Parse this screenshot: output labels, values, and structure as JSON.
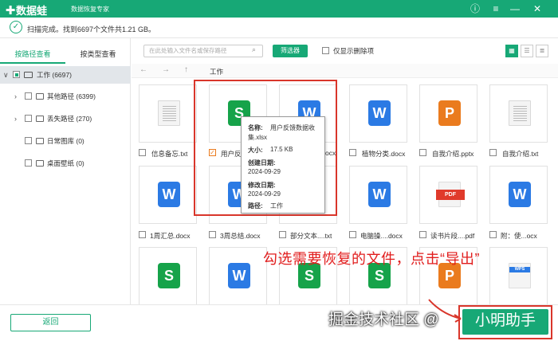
{
  "titlebar": {
    "app_name": "数据蛙",
    "subtitle": "数据恢复专家"
  },
  "status": {
    "text": "扫描完成。找到6697个文件共1.21 GB。"
  },
  "sidebar": {
    "tabs": [
      {
        "label": "按路径查看"
      },
      {
        "label": "按类型查看"
      }
    ],
    "tree": [
      {
        "label": "工作 (6697)"
      },
      {
        "label": "其他路径 (6399)"
      },
      {
        "label": "丢失路径 (270)"
      },
      {
        "label": "日常图库 (0)"
      },
      {
        "label": "桌面壁纸 (0)"
      }
    ]
  },
  "toolbar": {
    "search_placeholder": "在此处输入文件名或保存路径",
    "filter_label": "筛选器",
    "only_deleted_label": "仅显示删除项"
  },
  "nav": {
    "path": "工作"
  },
  "files": [
    {
      "name": "信息备忘.txt",
      "icon": "txt",
      "glyph": ""
    },
    {
      "name": "用户反",
      "icon": "s",
      "glyph": "S"
    },
    {
      "name": "ocx",
      "icon": "w",
      "glyph": "W"
    },
    {
      "name": "植物分类.docx",
      "icon": "w",
      "glyph": "W"
    },
    {
      "name": "自我介绍.pptx",
      "icon": "p",
      "glyph": "P"
    },
    {
      "name": "自我介绍.txt",
      "icon": "txt",
      "glyph": ""
    },
    {
      "name": "1周汇总.docx",
      "icon": "w",
      "glyph": "W"
    },
    {
      "name": "3周总结.docx",
      "icon": "w",
      "glyph": "W"
    },
    {
      "name": "部分文本....txt",
      "icon": "w",
      "glyph": "W"
    },
    {
      "name": "电脑操....docx",
      "icon": "w",
      "glyph": "W"
    },
    {
      "name": "读书片段....pdf",
      "icon": "pdf",
      "glyph": "PDF"
    },
    {
      "name": "附：使...ocx",
      "icon": "w",
      "glyph": "W"
    },
    {
      "name": "",
      "icon": "s",
      "glyph": "S"
    },
    {
      "name": "",
      "icon": "w",
      "glyph": "W"
    },
    {
      "name": "",
      "icon": "s",
      "glyph": "S"
    },
    {
      "name": "",
      "icon": "s",
      "glyph": "S"
    },
    {
      "name": "",
      "icon": "p",
      "glyph": "P"
    },
    {
      "name": "",
      "icon": "wps",
      "glyph": "WPS"
    }
  ],
  "tooltip": {
    "name_label": "名称:",
    "name_value": "用户反馈数据收",
    "name_value2": "集.xlsx",
    "size_label": "大小:",
    "size_value": "17.5 KB",
    "created_label": "创建日期:",
    "created_value": "2024-09-29",
    "modified_label": "修改日期:",
    "modified_value": "2024-09-29",
    "path_label": "路径:",
    "path_value": "工作"
  },
  "annotation": "勾选需要恢复的文件，点击“导出”",
  "footer": {
    "back_label": "返回",
    "export_label": "小明助手",
    "watermark": "掘金技术社区 @"
  }
}
